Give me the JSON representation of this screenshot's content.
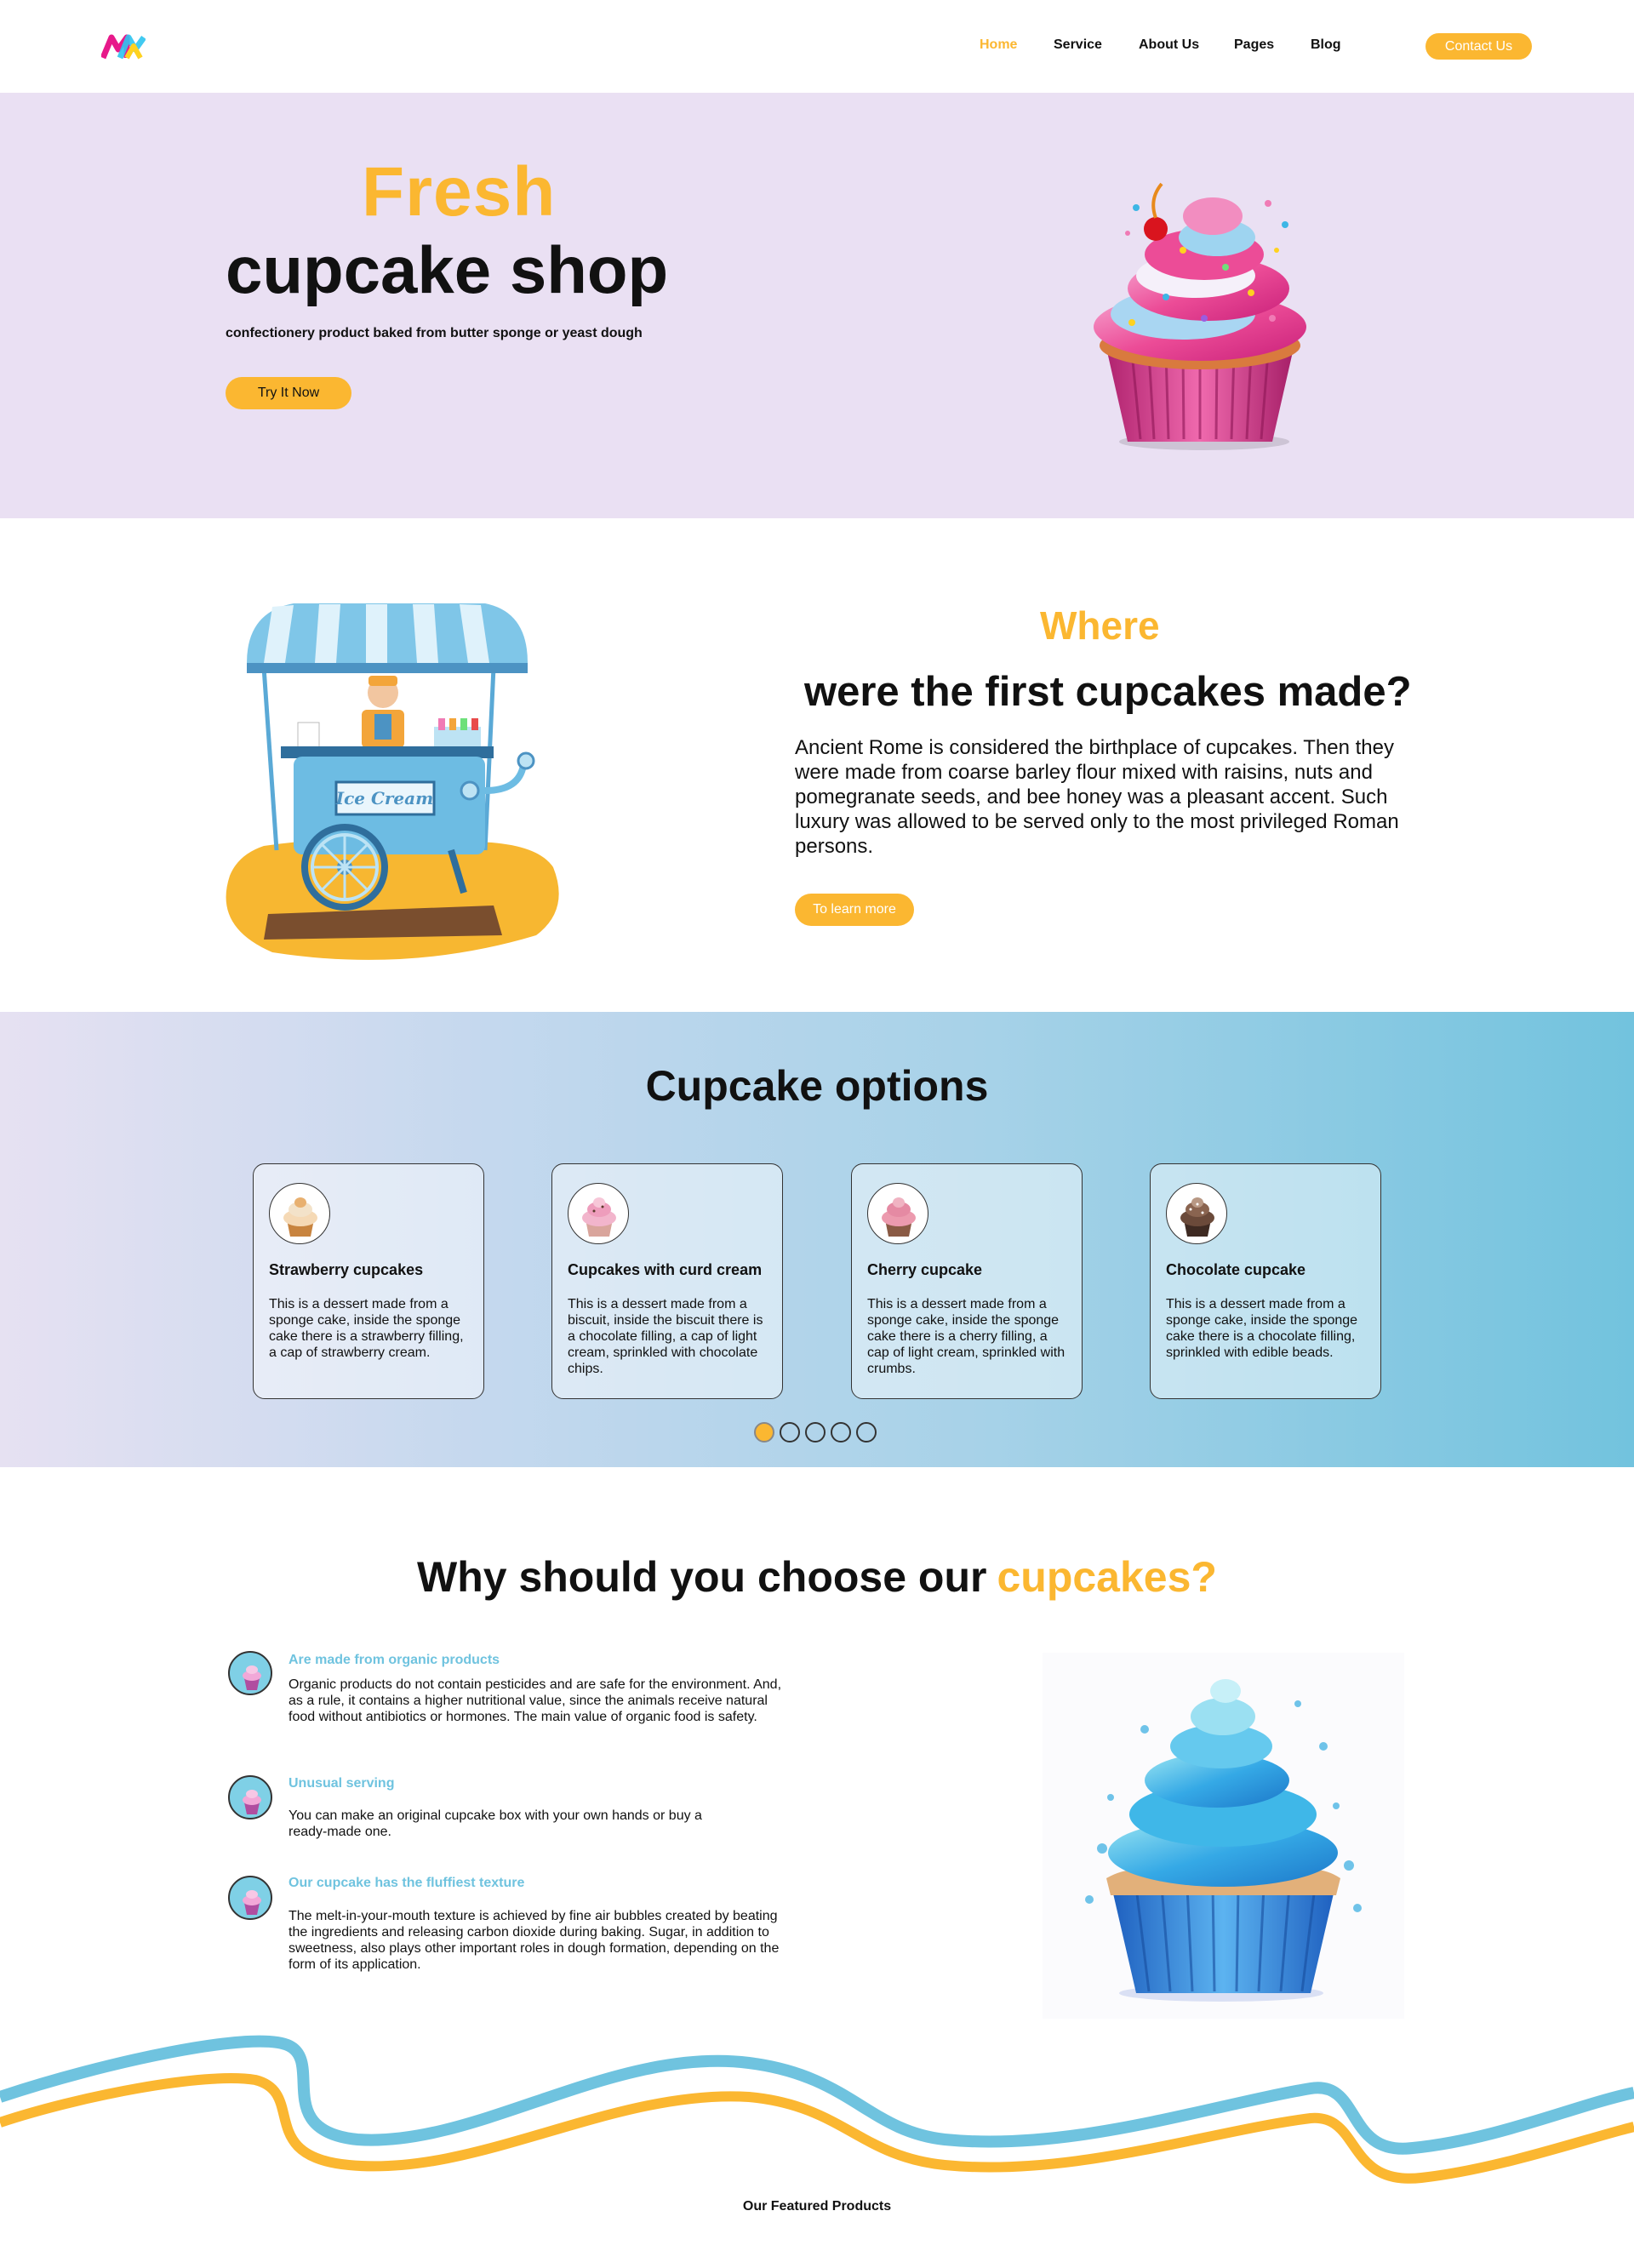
{
  "header": {
    "nav": [
      {
        "label": "Home",
        "active": true
      },
      {
        "label": "Service",
        "active": false
      },
      {
        "label": "About Us",
        "active": false
      },
      {
        "label": "Pages",
        "active": false
      },
      {
        "label": "Blog",
        "active": false
      }
    ],
    "contact_label": "Contact Us"
  },
  "hero": {
    "accent": "Fresh",
    "title": "cupcake shop",
    "subtitle": "confectionery product baked from butter sponge or yeast dough",
    "button": "Try It Now"
  },
  "about": {
    "accent": "Where",
    "title": "were the first cupcakes made?",
    "text": "Ancient Rome is considered the birthplace of cupcakes. Then they were made from coarse barley flour mixed with raisins, nuts and pomegranate seeds, and bee honey was a pleasant accent. Such luxury was allowed to be served only to the most privileged Roman persons.",
    "button": "To learn more",
    "cart_sign": "Ice Cream"
  },
  "options": {
    "title": "Cupcake options",
    "cards": [
      {
        "title": "Strawberry cupcakes",
        "text": "This is a dessert made from a sponge cake, inside the sponge cake there is a strawberry filling, a cap of strawberry cream."
      },
      {
        "title": "Cupcakes with curd cream",
        "text": "This is a dessert made from a biscuit, inside the biscuit there is a chocolate filling, a cap of light cream, sprinkled with chocolate chips."
      },
      {
        "title": "Cherry cupcake",
        "text": "This is a dessert made from a sponge cake, inside the sponge cake there is a cherry filling, a cap of light cream, sprinkled with crumbs."
      },
      {
        "title": "Chocolate cupcake",
        "text": "This is a dessert made from a sponge cake, inside the sponge cake there is a chocolate filling, sprinkled with edible beads."
      }
    ],
    "active_dot": 0,
    "dot_count": 5
  },
  "why": {
    "title": "Why should you choose our",
    "title_accent": "cupcakes?",
    "features": [
      {
        "title": "Are made from organic products",
        "text": "Organic products do not contain pesticides and are safe for the environment. And, as a rule, it contains a higher nutritional value, since the animals receive natural food without antibiotics or hormones. The main value of organic food is safety."
      },
      {
        "title": "Unusual serving",
        "text": "You can make an original cupcake box with your own hands or buy a ready-made one."
      },
      {
        "title": "Our cupcake has the fluffiest texture",
        "text": "The melt-in-your-mouth texture is achieved by fine air bubbles created by beating the ingredients and releasing carbon dioxide during baking. Sugar, in addition to sweetness, also plays other important roles in dough formation, depending on the form of its application."
      }
    ]
  },
  "featured": "Our Featured Products",
  "colors": {
    "accent": "#FBB731",
    "hero_bg": "#EAE0F3",
    "feature_heading": "#6FC3DF",
    "wave_blue": "#6FC3DF",
    "wave_yellow": "#FBB731"
  }
}
